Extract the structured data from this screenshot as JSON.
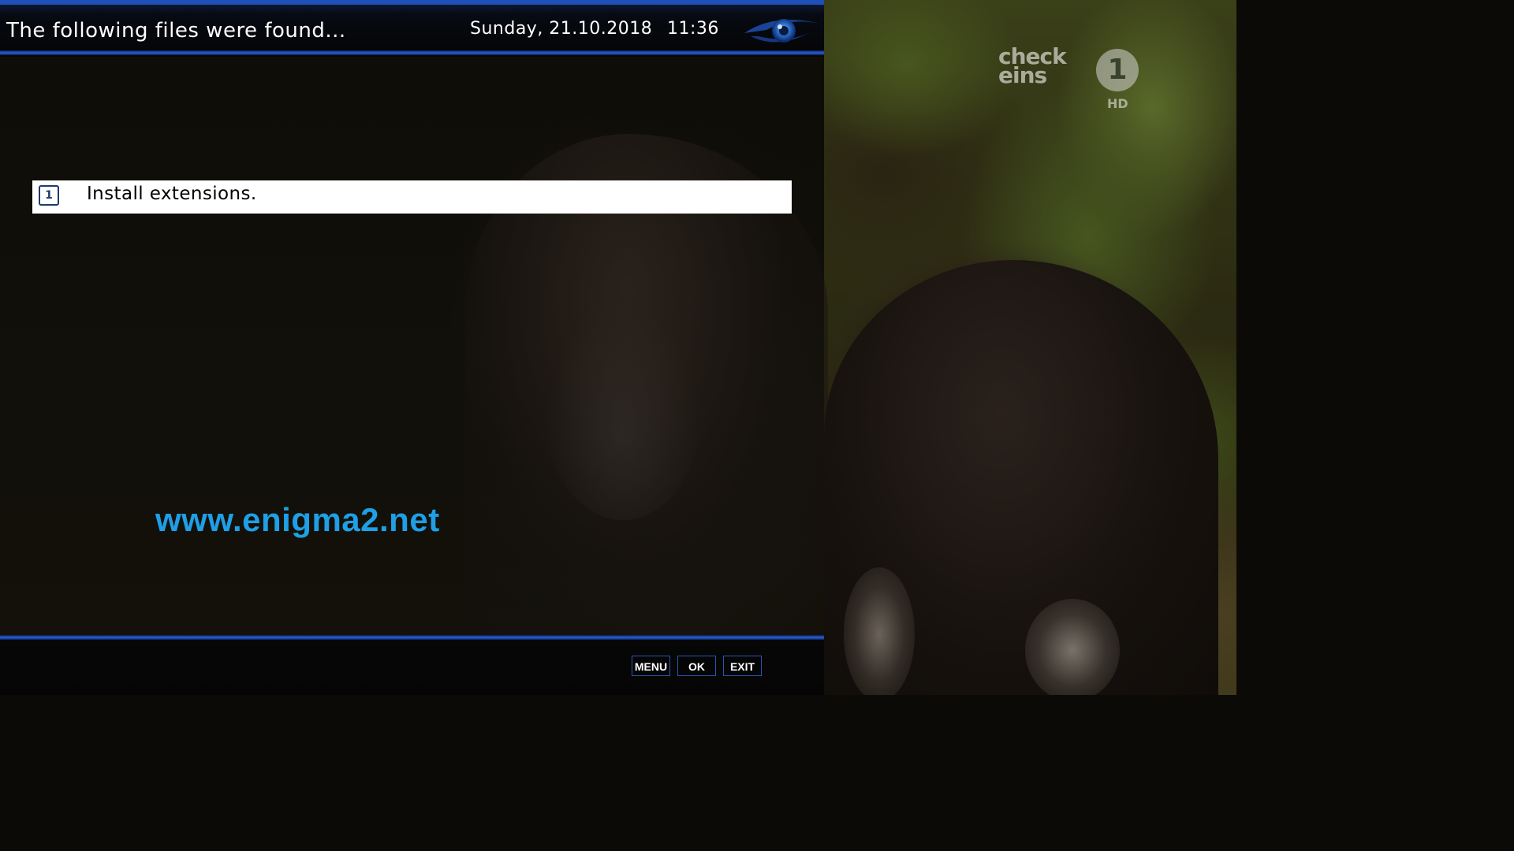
{
  "header": {
    "title": "The following files were found...",
    "date": "Sunday, 21.10.2018",
    "time": "11:36",
    "brand_icon": "eye-logo-icon"
  },
  "list": {
    "items": [
      {
        "number": "1",
        "label": "Install extensions.",
        "selected": true
      }
    ]
  },
  "watermark": "www.enigma2.net",
  "footer": {
    "buttons": [
      {
        "label": "MENU"
      },
      {
        "label": "OK"
      },
      {
        "label": "EXIT"
      }
    ]
  },
  "channel": {
    "logo_text": "check eins",
    "number": "1",
    "badge": "HD"
  },
  "colors": {
    "accent": "#2a63d8",
    "watermark": "#1e9fe6",
    "selection_bg": "#ffffff"
  }
}
